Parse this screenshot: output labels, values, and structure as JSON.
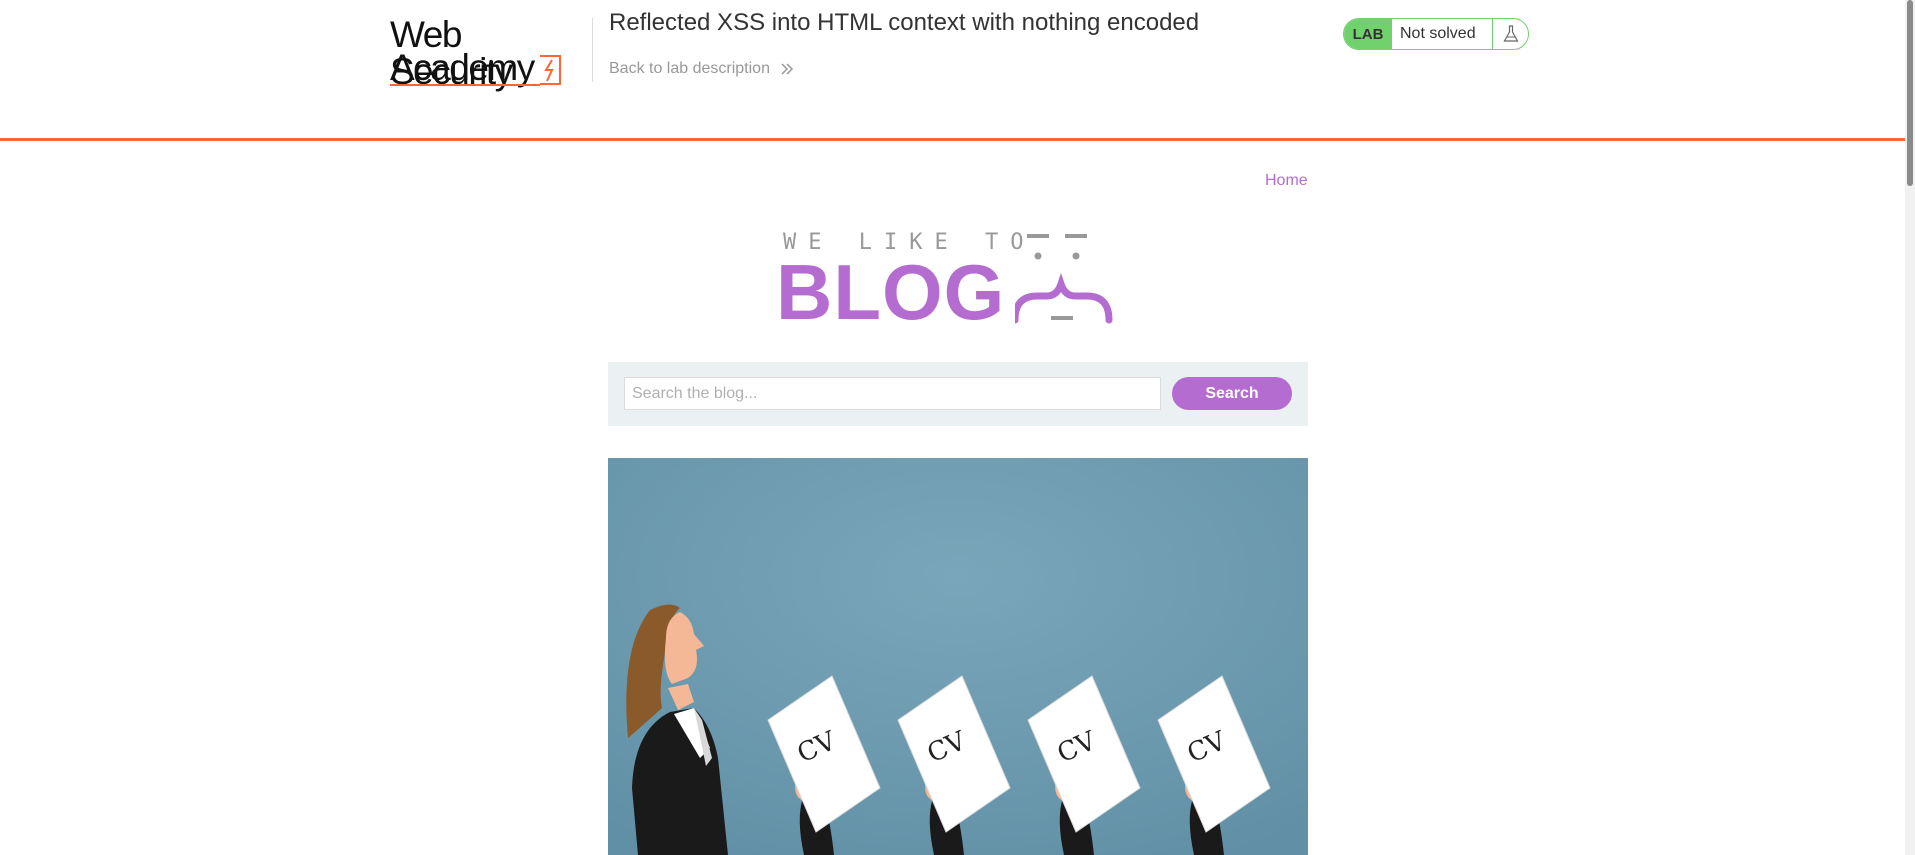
{
  "header": {
    "logo": {
      "line1": "Web Security",
      "line2": "Academy"
    },
    "lab_title": "Reflected XSS into HTML context with nothing encoded",
    "back_link": "Back to lab description",
    "lab_status": {
      "tag": "LAB",
      "status": "Not solved",
      "icon": "flask-icon"
    }
  },
  "nav": {
    "home": "Home"
  },
  "blog_logo": {
    "tagline": "WE LIKE TO",
    "word": "BLOG"
  },
  "search": {
    "placeholder": "Search the blog...",
    "value": "",
    "button": "Search"
  },
  "post_image": {
    "labels": [
      "CV",
      "CV",
      "CV",
      "CV"
    ]
  },
  "colors": {
    "accent": "#b46cd0",
    "academy_orange": "#ff6633",
    "lab_green": "#70d16d",
    "image_bg": "#6b98ad"
  }
}
